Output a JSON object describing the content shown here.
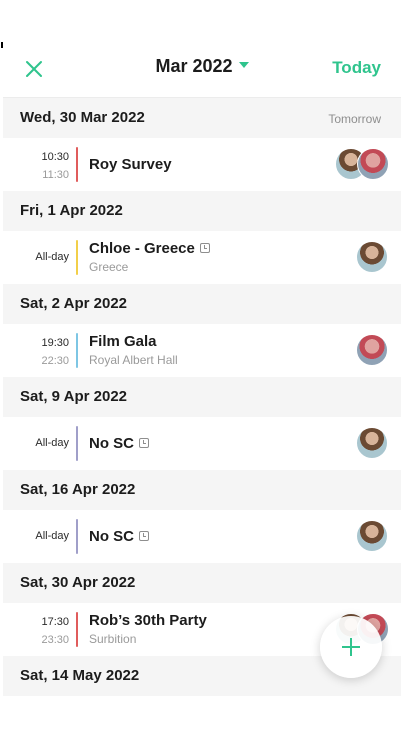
{
  "header": {
    "month_label": "Mar 2022",
    "today_label": "Today"
  },
  "accent_color": "#2fc48d",
  "days": [
    {
      "label": "Wed, 30 Mar 2022",
      "note": "Tomorrow",
      "event": {
        "start": "10:30",
        "end": "11:30",
        "title": "Roy Survey",
        "subtitle": "",
        "color": "#e05c5c",
        "avatars": 2
      }
    },
    {
      "label": "Fri, 1 Apr 2022",
      "note": "",
      "event": {
        "allday": "All-day",
        "title": "Chloe - Greece",
        "subtitle": "Greece",
        "color": "#f2cf4a",
        "avatars": 1,
        "reminder": true
      }
    },
    {
      "label": "Sat, 2 Apr 2022",
      "note": "",
      "event": {
        "start": "19:30",
        "end": "22:30",
        "title": "Film Gala",
        "subtitle": "Royal Albert Hall",
        "color": "#7ec6e4",
        "avatars": 1
      }
    },
    {
      "label": "Sat, 9 Apr 2022",
      "note": "",
      "event": {
        "allday": "All-day",
        "title": "No SC",
        "subtitle": "",
        "color": "#a09fc9",
        "avatars": 1,
        "reminder": true
      }
    },
    {
      "label": "Sat, 16 Apr 2022",
      "note": "",
      "event": {
        "allday": "All-day",
        "title": "No SC",
        "subtitle": "",
        "color": "#a09fc9",
        "avatars": 1,
        "reminder": true
      }
    },
    {
      "label": "Sat, 30 Apr 2022",
      "note": "",
      "event": {
        "start": "17:30",
        "end": "23:30",
        "title": "Rob’s 30th Party",
        "subtitle": "Surbition",
        "color": "#e05c5c",
        "avatars": 2
      }
    },
    {
      "label": "Sat, 14 May 2022",
      "note": ""
    }
  ],
  "icons": {
    "close": "close-icon",
    "dropdown": "chevron-down-icon",
    "reminder": "clock-icon",
    "add": "plus-icon"
  }
}
